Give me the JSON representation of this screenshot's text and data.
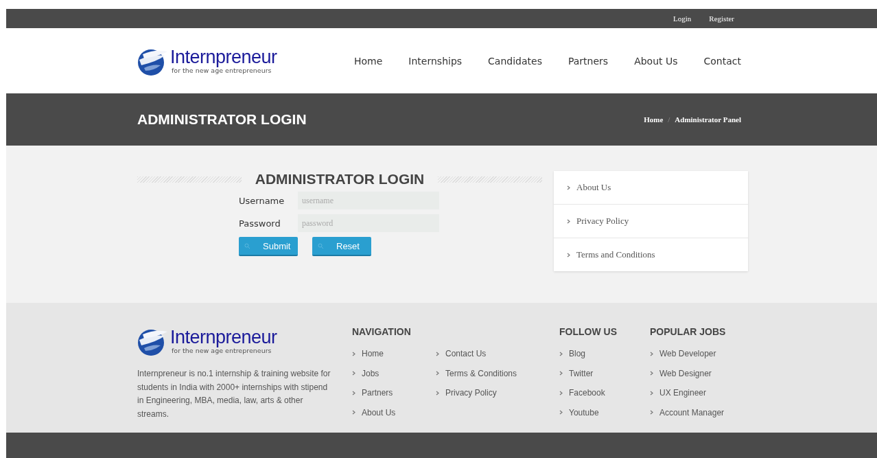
{
  "top_bar": {
    "links": [
      "Login",
      "Register"
    ]
  },
  "header": {
    "logo": {
      "name": "Internpreneur",
      "tagline": "for the new age entrepreneurs"
    },
    "nav": [
      {
        "label": "Home"
      },
      {
        "label": "Internships"
      },
      {
        "label": "Candidates"
      },
      {
        "label": "Partners"
      },
      {
        "label": "About Us"
      },
      {
        "label": "Contact"
      }
    ]
  },
  "title_band": {
    "title": "ADMINISTRATOR LOGIN",
    "breadcrumbs": [
      "Home",
      "Administrator Panel"
    ],
    "separator": "/"
  },
  "login": {
    "heading": "ADMINISTRATOR LOGIN",
    "fields": [
      {
        "label": "Username",
        "placeholder": "username"
      },
      {
        "label": "Password",
        "placeholder": "password"
      }
    ],
    "buttons": [
      "Submit",
      "Reset"
    ]
  },
  "side_menu": [
    {
      "label": "About Us"
    },
    {
      "label": "Privacy Policy"
    },
    {
      "label": "Terms and Conditions"
    }
  ],
  "footer": {
    "logo": {
      "name": "Internpreneur",
      "tagline": "for the new age entrepreneurs"
    },
    "about": "Internpreneur is no.1 internship & training website for students in India with 2000+ internships with stipend in Engineering, MBA, media, law, arts & other streams.",
    "navigation": {
      "heading": "NAVIGATION",
      "columns": [
        [
          "Home",
          "Jobs",
          "Partners",
          "About Us"
        ],
        [
          "Contact Us",
          "Terms & Conditions",
          "Privacy Policy"
        ]
      ]
    },
    "follow_us": {
      "heading": "FOLLOW US",
      "links": [
        "Blog",
        "Twitter",
        "Facebook",
        "Youtube"
      ]
    },
    "popular_jobs": {
      "heading": "POPULAR JOBS",
      "links": [
        "Web Developer",
        "Web Designer",
        "UX Engineer",
        "Account Manager"
      ]
    }
  }
}
